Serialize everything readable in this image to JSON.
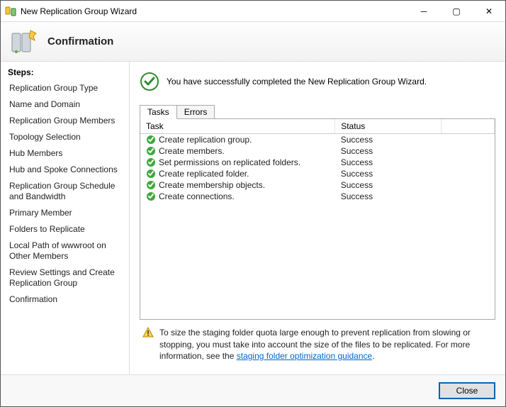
{
  "window": {
    "title": "New Replication Group Wizard"
  },
  "banner": {
    "title": "Confirmation"
  },
  "sidebar": {
    "steps_label": "Steps:",
    "items": [
      {
        "label": "Replication Group Type"
      },
      {
        "label": "Name and Domain"
      },
      {
        "label": "Replication Group Members"
      },
      {
        "label": "Topology Selection"
      },
      {
        "label": "Hub Members"
      },
      {
        "label": "Hub and Spoke Connections"
      },
      {
        "label": "Replication Group Schedule and Bandwidth"
      },
      {
        "label": "Primary Member"
      },
      {
        "label": "Folders to Replicate"
      },
      {
        "label": "Local Path of wwwroot on Other Members"
      },
      {
        "label": "Review Settings and Create Replication Group"
      },
      {
        "label": "Confirmation"
      }
    ]
  },
  "success_message": "You have successfully completed the New Replication Group Wizard.",
  "tabs": {
    "tasks": "Tasks",
    "errors": "Errors"
  },
  "table": {
    "columns": {
      "task": "Task",
      "status": "Status"
    },
    "rows": [
      {
        "task": "Create replication group.",
        "status": "Success"
      },
      {
        "task": "Create members.",
        "status": "Success"
      },
      {
        "task": "Set permissions on replicated folders.",
        "status": "Success"
      },
      {
        "task": "Create replicated folder.",
        "status": "Success"
      },
      {
        "task": "Create membership objects.",
        "status": "Success"
      },
      {
        "task": "Create connections.",
        "status": "Success"
      }
    ]
  },
  "warning": {
    "text_before_link": "To size the staging folder quota large enough to prevent replication from slowing or stopping, you must take into account the size of the files to be replicated. For more information, see the ",
    "link_text": "staging folder optimization guidance",
    "text_after_link": "."
  },
  "buttons": {
    "close": "Close"
  }
}
